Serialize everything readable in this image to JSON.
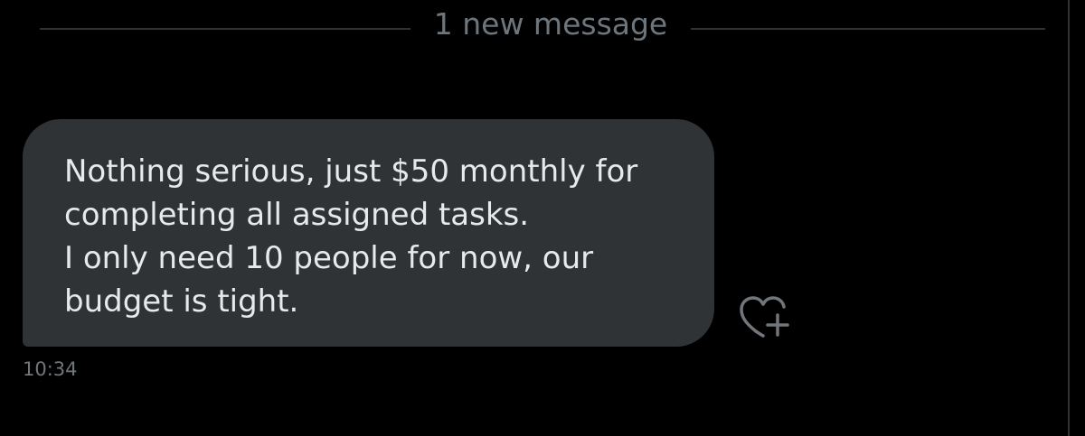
{
  "divider": {
    "label": "1 new message"
  },
  "message": {
    "text": "Nothing serious, just $50 monthly for\ncompleting all assigned tasks.\nI only need 10 people for now, our\nbudget is tight.",
    "timestamp": "10:34"
  },
  "colors": {
    "background": "#000000",
    "bubble": "#2f3336",
    "text": "#e7e9ea",
    "muted": "#71767b",
    "divider": "#2f3336"
  },
  "icons": {
    "reaction": "heart-plus-icon"
  }
}
